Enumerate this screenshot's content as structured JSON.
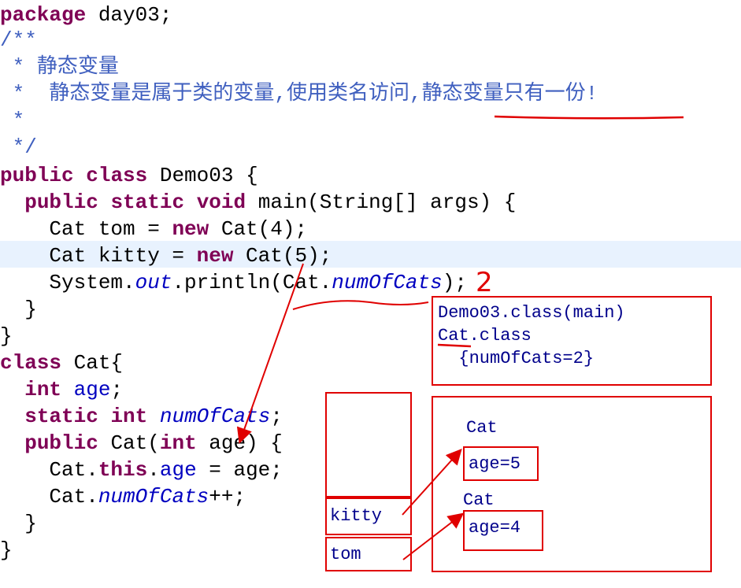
{
  "code": {
    "l1_kw": "package",
    "l1_rest": " day03;",
    "l2": "/**",
    "l3_star": " * ",
    "l3_text": "静态变量",
    "l4_star": " *  ",
    "l4_text": "静态变量是属于类的变量,使用类名访问,静态变量只有一份!",
    "l5": " *",
    "l6": " */",
    "l7_kw1": "public",
    "l7_kw2": "class",
    "l7_rest": " Demo03 {",
    "l8_indent": "  ",
    "l8_kw1": "public",
    "l8_kw2": "static",
    "l8_kw3": "void",
    "l8_rest": " main(String[] args) {",
    "l9_a": "    Cat tom = ",
    "l9_kw": "new",
    "l9_b": " Cat(4);",
    "l10_a": "    Cat kitty = ",
    "l10_kw": "new",
    "l10_b": " Cat(5);",
    "l11_a": "    System.",
    "l11_out": "out",
    "l11_b": ".println(Cat.",
    "l11_field": "numOfCats",
    "l11_c": ");",
    "l12": "  }",
    "l13": "}",
    "l14_kw": "class",
    "l14_rest": " Cat{",
    "l15_indent": "  ",
    "l15_kw": "int",
    "l15_field": "age",
    "l15_end": ";",
    "l16_indent": "  ",
    "l16_kw1": "static",
    "l16_kw2": "int",
    "l16_field": "numOfCats",
    "l16_end": ";",
    "l17_indent": "  ",
    "l17_kw1": "public",
    "l17_mid": " Cat(",
    "l17_kw2": "int",
    "l17_rest": " age) {",
    "l18_a": "    Cat.",
    "l18_kw": "this",
    "l18_dot": ".",
    "l18_field": "age",
    "l18_b": " = age;",
    "l19_a": "    Cat.",
    "l19_field": "numOfCats",
    "l19_b": "++;",
    "l20": "  }",
    "l21": "}"
  },
  "annotations": {
    "number_mark": "2",
    "method_area": {
      "line1": "Demo03.class(main)",
      "line2": "Cat.class",
      "line3": "  {numOfCats=2}"
    },
    "stack": {
      "kitty": "kitty",
      "tom": "tom"
    },
    "heap": {
      "obj1_title": "Cat",
      "obj1_field": "age=5",
      "obj2_title": "Cat",
      "obj2_field": "age=4"
    }
  },
  "colors": {
    "keyword": "#7f0055",
    "comment": "#3f5fbf",
    "field": "#0000c0",
    "annotation": "#e00000",
    "current_line": "#e8f2fe"
  }
}
